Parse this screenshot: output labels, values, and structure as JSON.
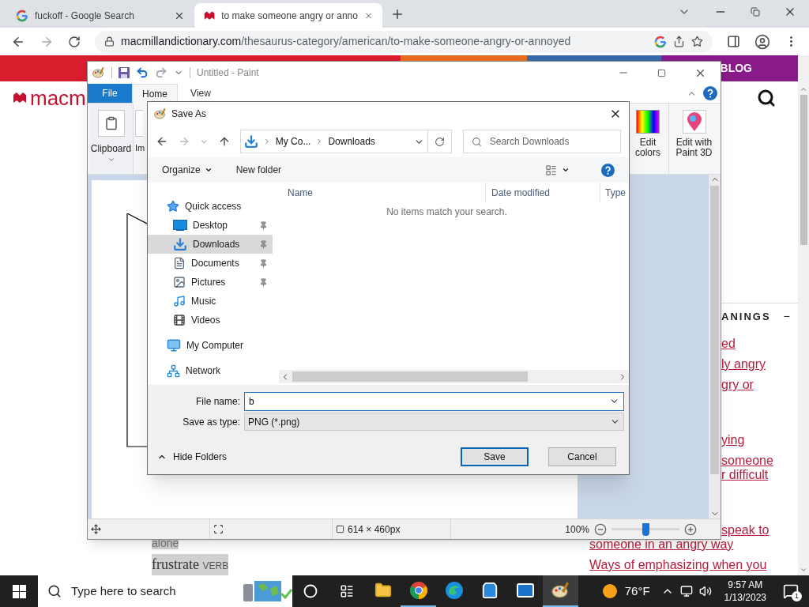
{
  "browser": {
    "tabs": [
      {
        "kind": "search",
        "title": "fuckoff - Google Search",
        "selected": false
      },
      {
        "kind": "dictionary",
        "title": "to make someone angry or anno",
        "selected": true
      }
    ],
    "url": {
      "domain": "macmillandictionary.com",
      "path": "/thesaurus-category/american/to-make-someone-angry-or-annoyed"
    }
  },
  "page": {
    "logo": "macm",
    "blog": "BLOG",
    "heading": "ANINGS",
    "collapse": "−",
    "links": [
      {
        "kind": "fragment",
        "text": "ed"
      },
      {
        "kind": "fragment",
        "text": "ly angry"
      },
      {
        "kind": "fragment",
        "text": "gry or"
      },
      {
        "kind": "gap"
      },
      {
        "kind": "fragment",
        "text": "ying"
      },
      {
        "kind": "fragment",
        "text": "someone"
      },
      {
        "kind": "tail",
        "text": "r difficult"
      },
      {
        "kind": "gap"
      },
      {
        "kind": "fragment",
        "text": "speak to"
      },
      {
        "kind": "wrap",
        "text": "someone in an angry way"
      },
      {
        "kind": "line",
        "text": "Ways of emphasizing when you"
      }
    ],
    "word_fragment": "alone",
    "headword": "frustrate",
    "pos": "VERB"
  },
  "paint": {
    "title": "Untitled - Paint",
    "tabs": [
      {
        "kind": "file",
        "label": "File",
        "selected": false
      },
      {
        "kind": "tab",
        "label": "Home",
        "selected": true
      },
      {
        "kind": "tab",
        "label": "View",
        "selected": false
      }
    ],
    "groups": [
      {
        "kind": "clipboard",
        "label": "Clipboard"
      },
      {
        "kind": "image",
        "label": "Im"
      },
      {
        "kind": "spacer"
      },
      {
        "kind": "colors",
        "label": "Edit colors"
      },
      {
        "kind": "paint3d",
        "label": "Edit with Paint 3D"
      }
    ],
    "status": {
      "size": "614 × 460px",
      "zoom": "100%",
      "level": 0.5
    }
  },
  "dialog": {
    "title": "Save As",
    "path": [
      "My Co...",
      "Downloads"
    ],
    "search": {
      "placeholder": "Search Downloads"
    },
    "toolbar": [
      "Organize",
      "New folder"
    ],
    "nav": [
      {
        "kind": "star",
        "label": "Quick access",
        "selected": false,
        "children": [
          {
            "kind": "desktop",
            "label": "Desktop",
            "selected": false,
            "pinned": true
          },
          {
            "kind": "downloads",
            "label": "Downloads",
            "selected": true,
            "pinned": true
          },
          {
            "kind": "documents",
            "label": "Documents",
            "selected": false,
            "pinned": true
          },
          {
            "kind": "pictures",
            "label": "Pictures",
            "selected": false,
            "pinned": true
          },
          {
            "kind": "music",
            "label": "Music",
            "selected": false,
            "pinned": false
          },
          {
            "kind": "videos",
            "label": "Videos",
            "selected": false,
            "pinned": false
          }
        ]
      },
      {
        "kind": "computer",
        "label": "My Computer",
        "selected": false
      },
      {
        "kind": "network",
        "label": "Network",
        "selected": false
      }
    ],
    "columns": [
      "Name",
      "Date modified",
      "Type"
    ],
    "empty": "No items match your search.",
    "file_name": {
      "label": "File name:",
      "value": "b"
    },
    "file_type": {
      "label": "Save as type:",
      "value": "PNG (*.png)"
    },
    "hide_folders": "Hide Folders",
    "buttons": [
      {
        "kind": "default",
        "label": "Save"
      },
      {
        "kind": "normal",
        "label": "Cancel"
      }
    ]
  },
  "taskbar": {
    "search": {
      "placeholder": "Type here to search"
    },
    "apps": [
      {
        "kind": "explorer",
        "running": false,
        "selected": false
      },
      {
        "kind": "chrome",
        "running": true,
        "selected": false
      },
      {
        "kind": "edge",
        "running": false,
        "selected": false
      },
      {
        "kind": "store",
        "running": false,
        "selected": false
      },
      {
        "kind": "mail",
        "running": false,
        "selected": false
      },
      {
        "kind": "paint",
        "running": true,
        "selected": true
      }
    ],
    "weather": "76°F",
    "time": "9:57 AM",
    "date": "1/13/2023",
    "notifications": "1"
  }
}
